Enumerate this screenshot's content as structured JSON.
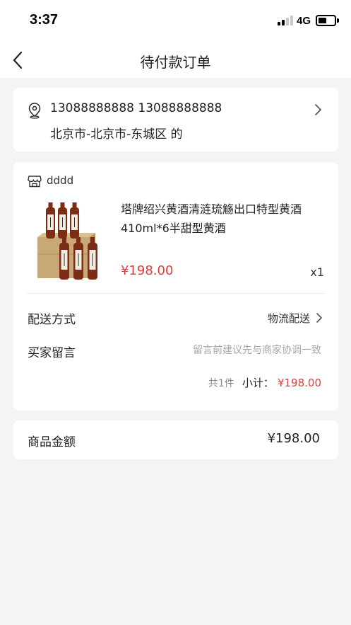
{
  "status_bar": {
    "time": "3:37",
    "network": "4G"
  },
  "nav": {
    "title": "待付款订单"
  },
  "address": {
    "contact": "13088888888 13088888888",
    "region": "北京市-北京市-东城区 的"
  },
  "order": {
    "shop_name": "dddd",
    "product": {
      "title": "塔牌绍兴黄酒清涟琉觞出口特型黄酒410ml*6半甜型黄酒",
      "price": "¥198.00",
      "quantity": "x1",
      "bottle_label": "黄酒"
    },
    "delivery": {
      "label": "配送方式",
      "value": "物流配送"
    },
    "note": {
      "label": "买家留言",
      "placeholder": "留言前建议先与商家协调一致"
    },
    "subtotal": {
      "count": "共1件",
      "label": "小计：",
      "value": "¥198.00"
    }
  },
  "summary": {
    "label": "商品金额",
    "value": "¥198.00"
  },
  "colors": {
    "accent": "#e63b3b",
    "background": "#f4f4f4"
  }
}
